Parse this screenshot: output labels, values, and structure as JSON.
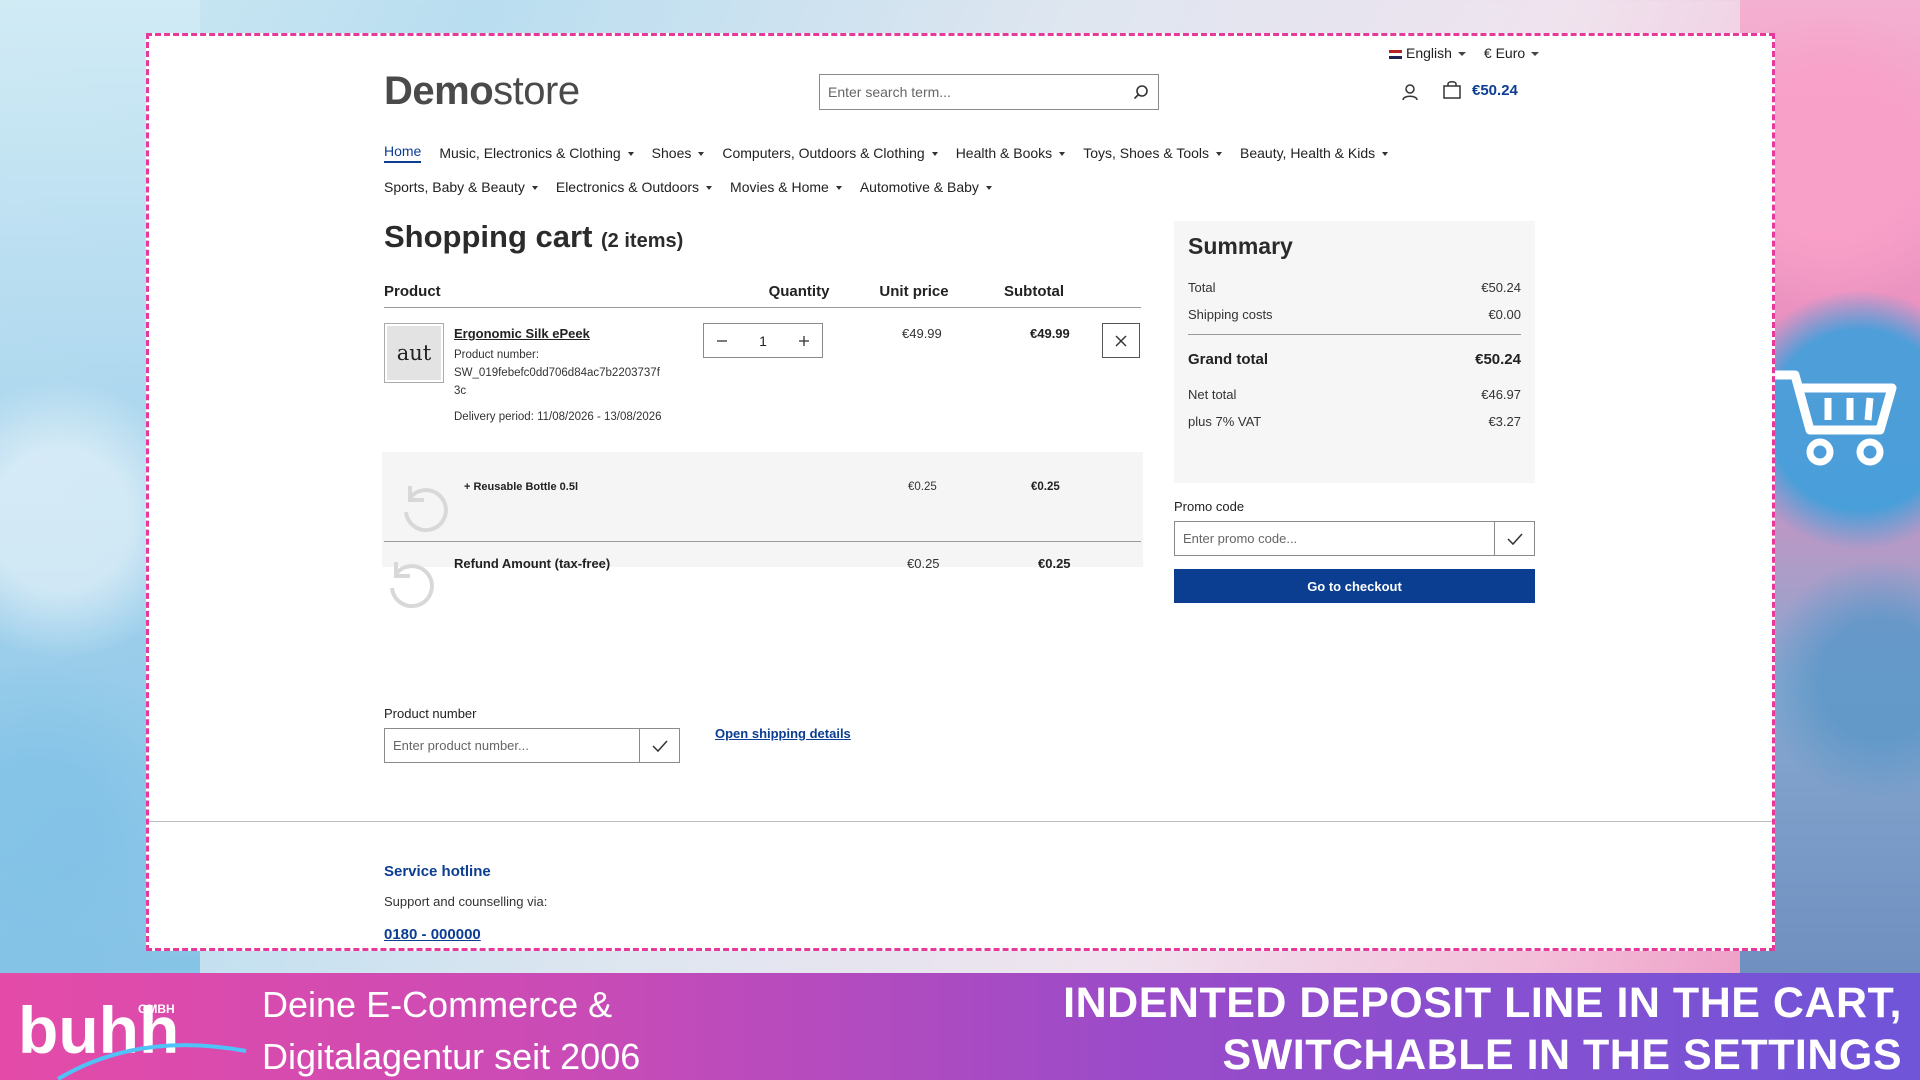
{
  "topbar": {
    "language": "English",
    "currency": "€ Euro"
  },
  "header": {
    "logo_bold": "Demo",
    "logo_light": "store",
    "search_placeholder": "Enter search term...",
    "cart_total": "€50.24"
  },
  "nav": {
    "row1": [
      {
        "label": "Home",
        "dropdown": false,
        "active": true
      },
      {
        "label": "Music, Electronics & Clothing",
        "dropdown": true
      },
      {
        "label": "Shoes",
        "dropdown": true
      },
      {
        "label": "Computers, Outdoors & Clothing",
        "dropdown": true
      },
      {
        "label": "Health & Books",
        "dropdown": true
      },
      {
        "label": "Toys, Shoes & Tools",
        "dropdown": true
      },
      {
        "label": "Beauty, Health & Kids",
        "dropdown": true
      }
    ],
    "row2": [
      {
        "label": "Sports, Baby & Beauty",
        "dropdown": true
      },
      {
        "label": "Electronics & Outdoors",
        "dropdown": true
      },
      {
        "label": "Movies & Home",
        "dropdown": true
      },
      {
        "label": "Automotive & Baby",
        "dropdown": true
      }
    ]
  },
  "cart": {
    "title": "Shopping cart",
    "count": "(2 items)",
    "headers": {
      "product": "Product",
      "quantity": "Quantity",
      "unit_price": "Unit price",
      "subtotal": "Subtotal"
    },
    "item": {
      "thumb_text": "aut",
      "name": "Ergonomic Silk ePeek",
      "number_label": "Product number:",
      "number": "SW_019febefc0dd706d84ac7b2203737f3c",
      "delivery": "Delivery period: 11/08/2026 - 13/08/2026",
      "quantity": "1",
      "unit_price": "€49.99",
      "subtotal": "€49.99"
    },
    "deposit": {
      "name": "+ Reusable Bottle 0.5l",
      "unit_price": "€0.25",
      "subtotal": "€0.25"
    },
    "refund": {
      "name": "Refund Amount (tax-free)",
      "unit_price": "€0.25",
      "subtotal": "€0.25"
    },
    "product_number_label": "Product number",
    "product_number_placeholder": "Enter product number...",
    "shipping_link": "Open shipping details"
  },
  "summary": {
    "title": "Summary",
    "total_label": "Total",
    "total": "€50.24",
    "shipping_label": "Shipping costs",
    "shipping": "€0.00",
    "grand_label": "Grand total",
    "grand": "€50.24",
    "net_label": "Net total",
    "net": "€46.97",
    "vat_label": "plus 7% VAT",
    "vat": "€3.27",
    "promo_label": "Promo code",
    "promo_placeholder": "Enter promo code...",
    "checkout": "Go to checkout"
  },
  "footer": {
    "hotline_title": "Service hotline",
    "hotline_desc": "Support and counselling via:",
    "hotline_phone": "0180 - 000000"
  },
  "banner": {
    "logo_text": "buhh",
    "logo_sub": "GMBH",
    "tagline_line1": "Deine E-Commerce &",
    "tagline_line2": "Digitalagentur seit 2006",
    "headline_line1": "INDENTED DEPOSIT LINE IN THE CART,",
    "headline_line2": "SWITCHABLE IN THE SETTINGS"
  },
  "colors": {
    "primary": "#0b3d91",
    "frame": "#e6399b"
  }
}
